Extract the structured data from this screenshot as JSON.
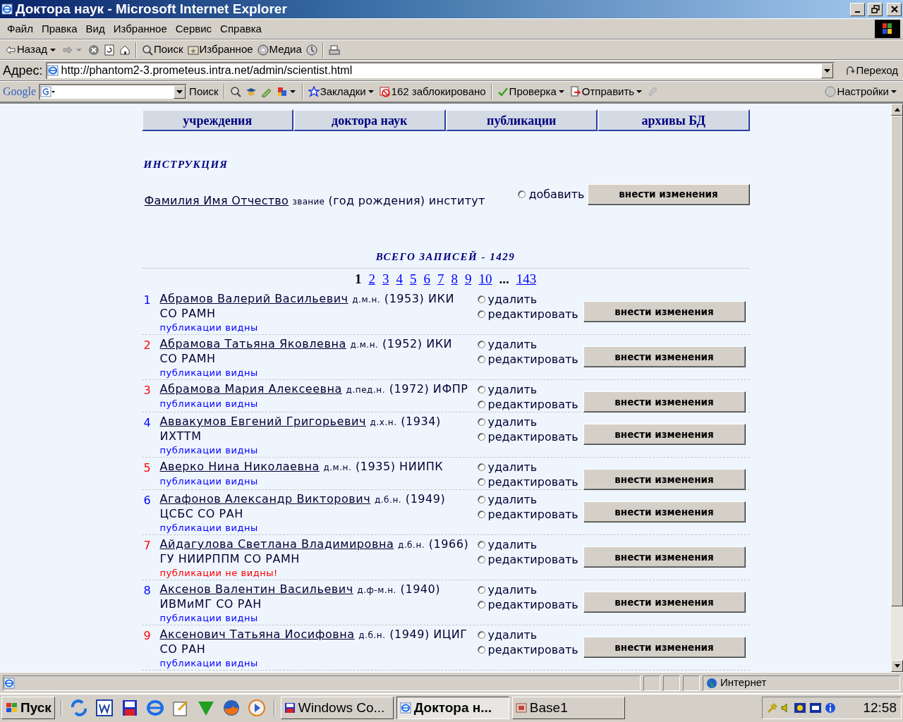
{
  "window": {
    "title": "Доктора наук - Microsoft Internet Explorer"
  },
  "menu": [
    "Файл",
    "Правка",
    "Вид",
    "Избранное",
    "Сервис",
    "Справка"
  ],
  "toolbar": [
    {
      "kind": "back",
      "label": "Назад"
    },
    {
      "kind": "forward"
    },
    {
      "kind": "stop"
    },
    {
      "kind": "refresh"
    },
    {
      "kind": "home"
    },
    {
      "kind": "search",
      "label": "Поиск"
    },
    {
      "kind": "favorites",
      "label": "Избранное"
    },
    {
      "kind": "media",
      "label": "Медиа"
    },
    {
      "kind": "history"
    },
    {
      "kind": "print"
    }
  ],
  "address": {
    "label": "Адрес:",
    "value": "http://phantom2-3.prometeus.intra.net/admin/scientist.html",
    "go": "Переход"
  },
  "google_bar": {
    "logo": "Google",
    "search": "Поиск",
    "bookmarks": "Закладки",
    "blocked": "162 заблокировано",
    "spell": "Проверка",
    "send": "Отправить",
    "settings": "Настройки"
  },
  "page": {
    "nav": [
      "учреждения",
      "доктора наук",
      "публикации",
      "архивы БД"
    ],
    "instruction": "ИНСТРУКЦИЯ",
    "legend": {
      "name": "Фамилия Имя Отчество",
      "rank": "звание",
      "rest": "(год рождения) институт"
    },
    "add_option": {
      "label": "добавить",
      "selected": false
    },
    "submit": "внести изменения",
    "total": "ВСЕГО ЗАПИСЕЙ - 1429",
    "pages": [
      {
        "label": "1",
        "selected": true
      },
      {
        "label": "2",
        "selected": false
      },
      {
        "label": "3",
        "selected": false
      },
      {
        "label": "4",
        "selected": false
      },
      {
        "label": "5",
        "selected": false
      },
      {
        "label": "6",
        "selected": false
      },
      {
        "label": "7",
        "selected": false
      },
      {
        "label": "8",
        "selected": false
      },
      {
        "label": "9",
        "selected": false
      },
      {
        "label": "10",
        "selected": false
      },
      {
        "label": "...",
        "kind": "gap"
      },
      {
        "label": "143",
        "selected": false
      }
    ],
    "records": [
      {
        "number": "1",
        "color": "#0000ff",
        "name": "Абрамов Валерий Васильевич",
        "rank": "д.м.н.",
        "rest": "(1953) ИКИ СО РАМН",
        "visibility": "публикации видны",
        "visible": true,
        "options": [
          {
            "label": "удалить",
            "selected": false
          },
          {
            "label": "редактировать",
            "selected": false
          }
        ],
        "button": "внести изменения"
      },
      {
        "number": "2",
        "color": "#ff0000",
        "name": "Абрамова Татьяна Яковлевна",
        "rank": "д.м.н.",
        "rest": "(1952) ИКИ СО РАМН",
        "visibility": "публикации видны",
        "visible": true,
        "options": [
          {
            "label": "удалить",
            "selected": false
          },
          {
            "label": "редактировать",
            "selected": false
          }
        ],
        "button": "внести изменения"
      },
      {
        "number": "3",
        "color": "#ff0000",
        "name": "Абрамова Мария Алексеевна",
        "rank": "д.пед.н.",
        "rest": "(1972) ИФПР",
        "visibility": "публикации видны",
        "visible": true,
        "options": [
          {
            "label": "удалить",
            "selected": false
          },
          {
            "label": "редактировать",
            "selected": false
          }
        ],
        "button": "внести изменения"
      },
      {
        "number": "4",
        "color": "#0000ff",
        "name": "Аввакумов Евгений Григорьевич",
        "rank": "д.х.н.",
        "rest": "(1934) ИХТТМ",
        "visibility": "публикации видны",
        "visible": true,
        "options": [
          {
            "label": "удалить",
            "selected": false
          },
          {
            "label": "редактировать",
            "selected": false
          }
        ],
        "button": "внести изменения"
      },
      {
        "number": "5",
        "color": "#ff0000",
        "name": "Аверко Нина Николаевна",
        "rank": "д.м.н.",
        "rest": "(1935) НИИПК",
        "visibility": "публикации видны",
        "visible": true,
        "options": [
          {
            "label": "удалить",
            "selected": false
          },
          {
            "label": "редактировать",
            "selected": false
          }
        ],
        "button": "внести изменения"
      },
      {
        "number": "6",
        "color": "#0000ff",
        "name": "Агафонов Александр Викторович",
        "rank": "д.б.н.",
        "rest": "(1949) ЦСБС СО РАН",
        "visibility": "публикации видны",
        "visible": true,
        "options": [
          {
            "label": "удалить",
            "selected": false
          },
          {
            "label": "редактировать",
            "selected": false
          }
        ],
        "button": "внести изменения"
      },
      {
        "number": "7",
        "color": "#ff0000",
        "name": "Айдагулова Светлана Владимировна",
        "rank": "д.б.н.",
        "rest": "(1966) ГУ НИИРППМ СО РАМН",
        "visibility": "публикации не видны!",
        "visible": false,
        "options": [
          {
            "label": "удалить",
            "selected": false
          },
          {
            "label": "редактировать",
            "selected": false
          }
        ],
        "button": "внести изменения"
      },
      {
        "number": "8",
        "color": "#0000ff",
        "name": "Аксенов Валентин Васильевич",
        "rank": "д.ф-м.н.",
        "rest": "(1940) ИВМиМГ СО РАН",
        "visibility": "публикации видны",
        "visible": true,
        "options": [
          {
            "label": "удалить",
            "selected": false
          },
          {
            "label": "редактировать",
            "selected": false
          }
        ],
        "button": "внести изменения"
      },
      {
        "number": "9",
        "color": "#ff0000",
        "name": "Аксенович Татьяна Иосифовна",
        "rank": "д.б.н.",
        "rest": "(1949) ИЦИГ СО РАН",
        "visibility": "публикации видны",
        "visible": true,
        "options": [
          {
            "label": "удалить",
            "selected": false
          },
          {
            "label": "редактировать",
            "selected": false
          }
        ],
        "button": "внести изменения"
      }
    ]
  },
  "status_bar": {
    "zone": "Интернет"
  },
  "taskbar": {
    "start": "Пуск",
    "tasks": [
      {
        "label": "Windows Co...",
        "selected": false
      },
      {
        "label": "Доктора н...",
        "selected": true
      },
      {
        "label": "Base1",
        "selected": false
      }
    ],
    "clock": "12:58"
  }
}
